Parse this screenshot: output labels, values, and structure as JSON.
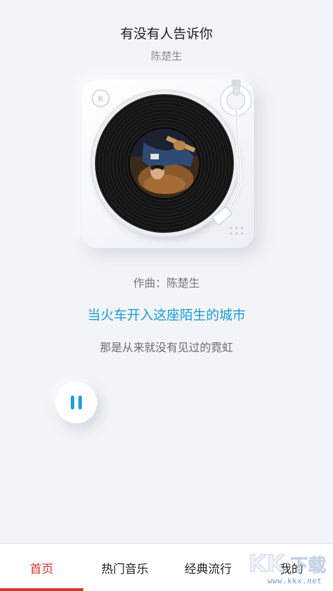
{
  "song": {
    "title": "有没有人告诉你",
    "artist": "陈楚生"
  },
  "player": {
    "brand_logo": "K",
    "state": "playing",
    "pause_icon": "pause-icon"
  },
  "lyrics": {
    "credit": "作曲：陈楚生",
    "current_line": "当火车开入这座陌生的城市",
    "next_line": "那是从来就没有见过的霓虹"
  },
  "nav": {
    "tabs": [
      {
        "label": "首页",
        "active": true
      },
      {
        "label": "热门音乐",
        "active": false
      },
      {
        "label": "经典流行",
        "active": false
      },
      {
        "label": "我的",
        "active": false
      }
    ]
  },
  "watermark": {
    "url": "www.kkx.net",
    "brand_glyphs": "KK下载"
  },
  "colors": {
    "accent_blue": "#1a9ad6",
    "active_red": "#d6322b",
    "background": "#f3f4f7"
  }
}
